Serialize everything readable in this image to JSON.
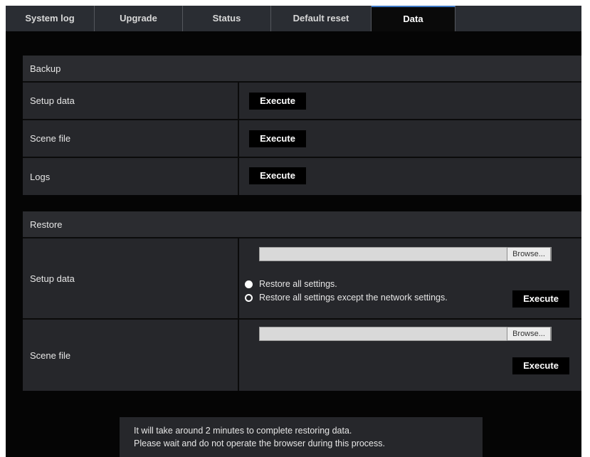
{
  "tabs": [
    {
      "label": "System log",
      "active": false
    },
    {
      "label": "Upgrade",
      "active": false
    },
    {
      "label": "Status",
      "active": false
    },
    {
      "label": "Default reset",
      "active": false
    },
    {
      "label": "Data",
      "active": true
    }
  ],
  "backup": {
    "title": "Backup",
    "rows": [
      {
        "label": "Setup data",
        "button": "Execute"
      },
      {
        "label": "Scene file",
        "button": "Execute"
      },
      {
        "label": "Logs",
        "button": "Execute"
      }
    ]
  },
  "restore": {
    "title": "Restore",
    "setup": {
      "label": "Setup data",
      "browse": "Browse...",
      "options": [
        {
          "label": "Restore all settings.",
          "checked": true
        },
        {
          "label": "Restore all settings except the network settings.",
          "checked": false
        }
      ],
      "button": "Execute"
    },
    "scene": {
      "label": "Scene file",
      "browse": "Browse...",
      "button": "Execute"
    }
  },
  "notice": {
    "line1": "It will take around 2 minutes to complete restoring data.",
    "line2": "Please wait and do not operate the browser during this process."
  },
  "colors": {
    "background": "#050505",
    "panel": "#26272b",
    "tab_bar": "#2a2d33",
    "active_tab_accent": "#3e79c6"
  }
}
